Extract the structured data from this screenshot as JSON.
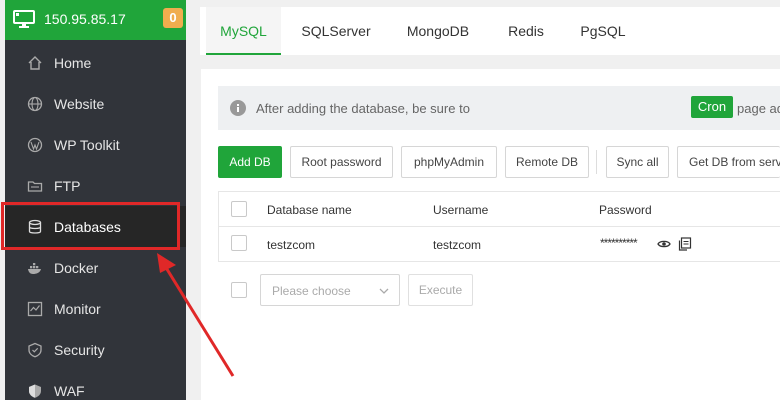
{
  "server": {
    "ip": "150.95.85.17",
    "badge_count": "0"
  },
  "sidebar": {
    "items": [
      {
        "label": "Home",
        "icon": "home-icon"
      },
      {
        "label": "Website",
        "icon": "globe-icon"
      },
      {
        "label": "WP Toolkit",
        "icon": "wordpress-icon"
      },
      {
        "label": "FTP",
        "icon": "ftp-icon"
      },
      {
        "label": "Databases",
        "icon": "database-icon",
        "active": true
      },
      {
        "label": "Docker",
        "icon": "docker-icon"
      },
      {
        "label": "Monitor",
        "icon": "monitor-icon"
      },
      {
        "label": "Security",
        "icon": "shield-icon"
      },
      {
        "label": "WAF",
        "icon": "waf-shield-icon"
      }
    ]
  },
  "tabs": [
    "MySQL",
    "SQLServer",
    "MongoDB",
    "Redis",
    "PgSQL"
  ],
  "active_tab": "MySQL",
  "notice": {
    "before": "After adding the database, be sure to",
    "cron": "Cron",
    "after": "page adds scheduled backup tasks to ensure y"
  },
  "toolbar": {
    "add_db": "Add DB",
    "root_password": "Root password",
    "phpmyadmin": "phpMyAdmin",
    "remote_db": "Remote DB",
    "sync_all": "Sync all",
    "get_db": "Get DB from serv"
  },
  "table": {
    "headers": [
      "Database name",
      "Username",
      "Password"
    ],
    "rows": [
      {
        "database": "testzcom",
        "username": "testzcom",
        "password": "**********"
      }
    ]
  },
  "batch": {
    "placeholder": "Please choose",
    "execute": "Execute"
  },
  "colors": {
    "accent": "#20a53a",
    "sidebar_bg": "#31343a",
    "badge": "#f0ad4e",
    "highlight": "#e02828"
  }
}
